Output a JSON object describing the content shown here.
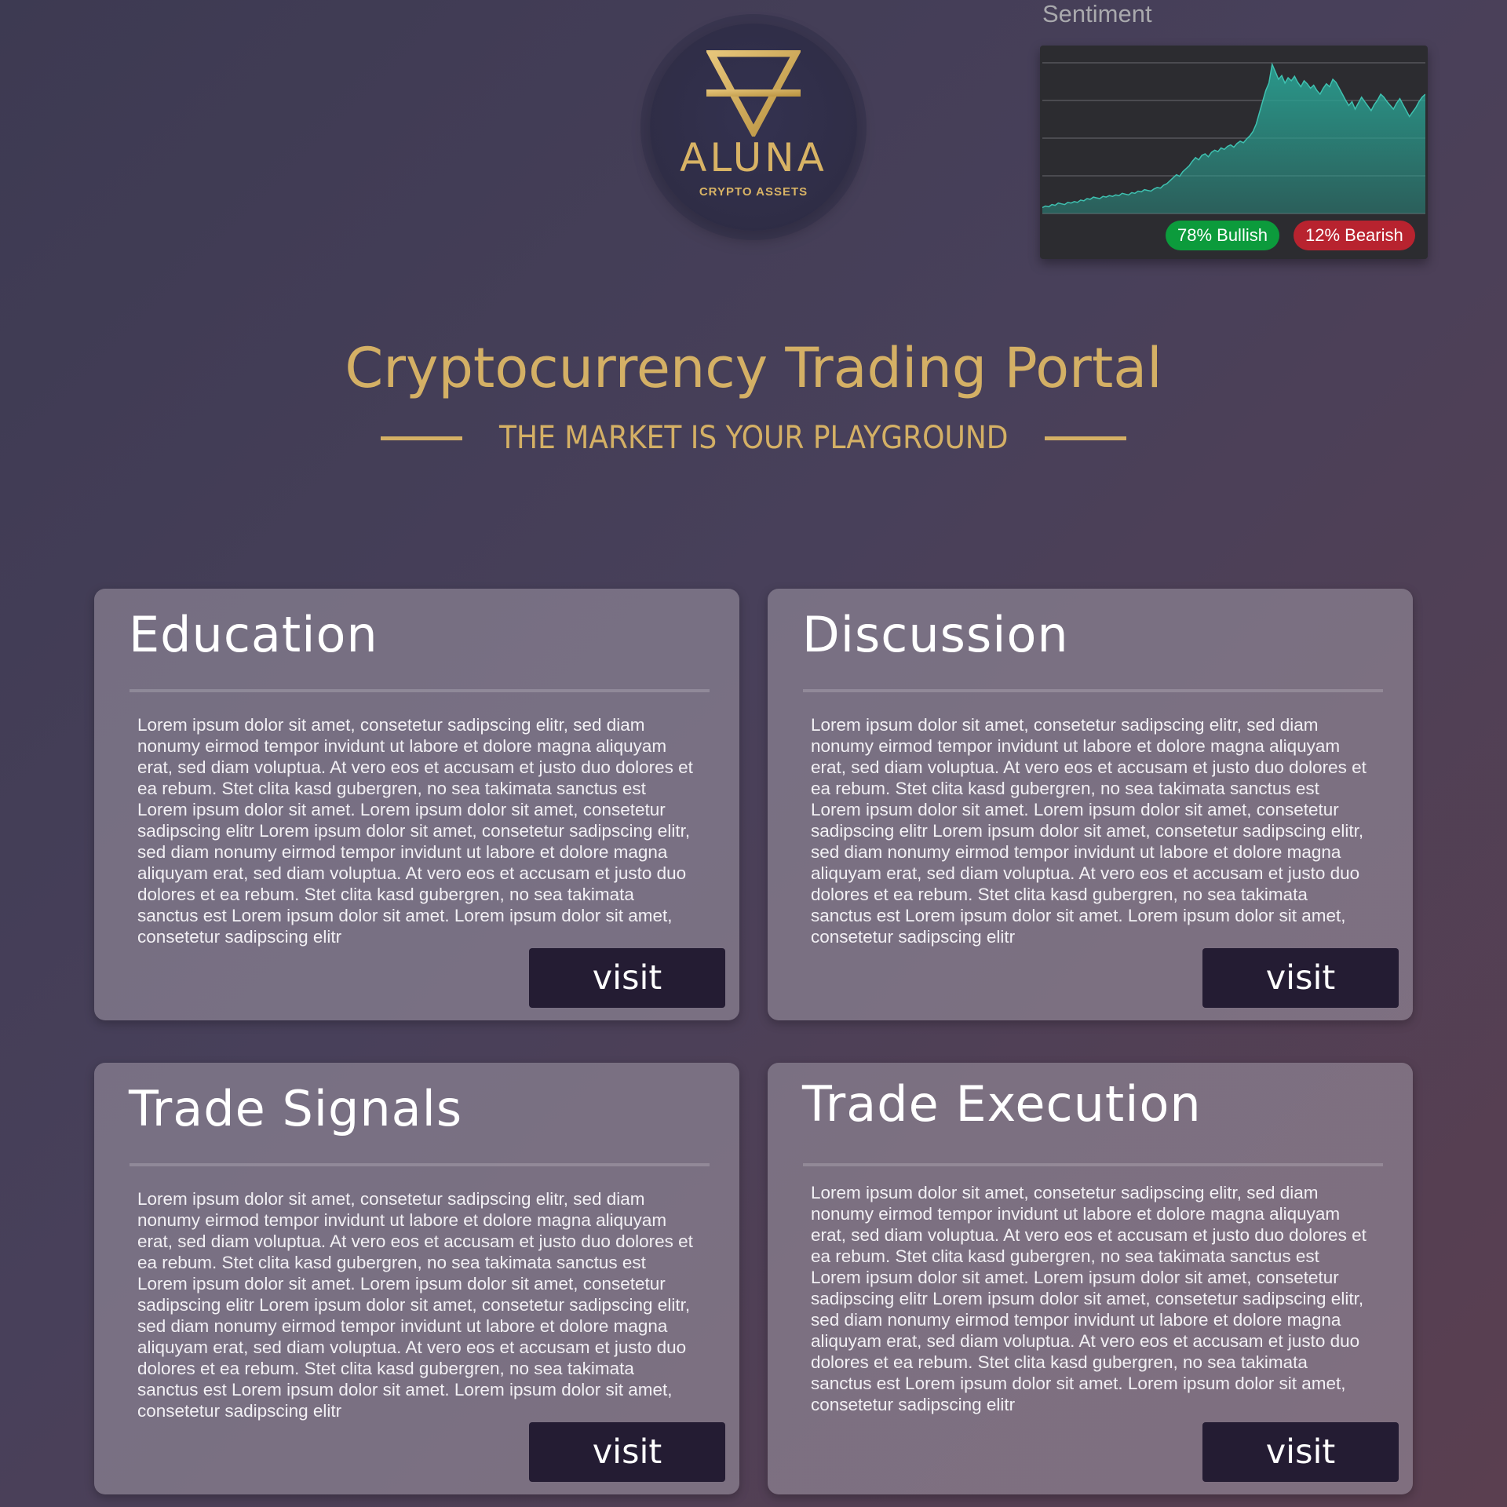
{
  "logo": {
    "brand": "ALUNA",
    "tagline": "CRYPTO ASSETS",
    "icon": "inverted-triangle-alchemy-icon",
    "color": "#d8b365"
  },
  "sentiment": {
    "label": "Sentiment",
    "bullish_text": "78% Bullish",
    "bearish_text": "12% Bearish",
    "bullish_pct": 78,
    "bearish_pct": 12,
    "bullish_color": "#0c9b3c",
    "bearish_color": "#b8232f",
    "chart_color": "#2a9d8f",
    "price_series": [
      8,
      10,
      9,
      12,
      11,
      14,
      13,
      12,
      15,
      14,
      16,
      15,
      18,
      17,
      20,
      19,
      22,
      21,
      20,
      23,
      22,
      24,
      23,
      25,
      24,
      27,
      26,
      25,
      28,
      27,
      30,
      29,
      32,
      31,
      30,
      33,
      35,
      34,
      38,
      40,
      44,
      48,
      52,
      50,
      56,
      60,
      64,
      70,
      75,
      72,
      78,
      80,
      76,
      82,
      85,
      83,
      88,
      86,
      90,
      92,
      89,
      94,
      97,
      95,
      100,
      104,
      110,
      120,
      135,
      150,
      165,
      175,
      200,
      190,
      180,
      185,
      175,
      182,
      178,
      184,
      176,
      170,
      178,
      174,
      168,
      172,
      165,
      160,
      168,
      174,
      170,
      180,
      176,
      168,
      160,
      152,
      145,
      150,
      140,
      148,
      156,
      150,
      144,
      138,
      146,
      152,
      160,
      156,
      150,
      145,
      140,
      148,
      154,
      146,
      138,
      130,
      136,
      142,
      150,
      156,
      160
    ]
  },
  "hero": {
    "title": "Cryptocurrency Trading Portal",
    "subtitle": "THE MARKET IS YOUR PLAYGROUND",
    "accent": "#d4b065"
  },
  "cards": [
    {
      "title": "Education",
      "body": "Lorem ipsum dolor sit amet, consetetur sadipscing elitr, sed diam nonumy eirmod tempor invidunt ut labore et dolore magna aliquyam erat, sed diam voluptua. At vero eos et accusam et justo duo dolores et ea rebum. Stet clita kasd gubergren, no sea takimata sanctus est Lorem ipsum dolor sit amet. Lorem ipsum dolor sit amet, consetetur sadipscing elitr Lorem ipsum dolor sit amet, consetetur sadipscing elitr, sed diam nonumy eirmod tempor invidunt ut labore et dolore magna aliquyam erat, sed diam voluptua. At vero eos et accusam et justo duo dolores et ea rebum. Stet clita kasd gubergren, no sea takimata sanctus est Lorem ipsum dolor sit amet. Lorem ipsum dolor sit amet, consetetur sadipscing elitr",
      "button": "visit"
    },
    {
      "title": "Discussion",
      "body": "Lorem ipsum dolor sit amet, consetetur sadipscing elitr, sed diam nonumy eirmod tempor invidunt ut labore et dolore magna aliquyam erat, sed diam voluptua. At vero eos et accusam et justo duo dolores et ea rebum. Stet clita kasd gubergren, no sea takimata sanctus est Lorem ipsum dolor sit amet. Lorem ipsum dolor sit amet, consetetur sadipscing elitr Lorem ipsum dolor sit amet, consetetur sadipscing elitr, sed diam nonumy eirmod tempor invidunt ut labore et dolore magna aliquyam erat, sed diam voluptua. At vero eos et accusam et justo duo dolores et ea rebum. Stet clita kasd gubergren, no sea takimata sanctus est Lorem ipsum dolor sit amet. Lorem ipsum dolor sit amet, consetetur sadipscing elitr",
      "button": "visit"
    },
    {
      "title": "Trade Signals",
      "body": "Lorem ipsum dolor sit amet, consetetur sadipscing elitr, sed diam nonumy eirmod tempor invidunt ut labore et dolore magna aliquyam erat, sed diam voluptua. At vero eos et accusam et justo duo dolores et ea rebum. Stet clita kasd gubergren, no sea takimata sanctus est Lorem ipsum dolor sit amet. Lorem ipsum dolor sit amet, consetetur sadipscing elitr Lorem ipsum dolor sit amet, consetetur sadipscing elitr, sed diam nonumy eirmod tempor invidunt ut labore et dolore magna aliquyam erat, sed diam voluptua. At vero eos et accusam et justo duo dolores et ea rebum. Stet clita kasd gubergren, no sea takimata sanctus est Lorem ipsum dolor sit amet. Lorem ipsum dolor sit amet, consetetur sadipscing elitr",
      "button": "visit"
    },
    {
      "title": "Trade Execution",
      "body": "Lorem ipsum dolor sit amet, consetetur sadipscing elitr, sed diam nonumy eirmod tempor invidunt ut labore et dolore magna aliquyam erat, sed diam voluptua. At vero eos et accusam et justo duo dolores et ea rebum. Stet clita kasd gubergren, no sea takimata sanctus est Lorem ipsum dolor sit amet. Lorem ipsum dolor sit amet, consetetur sadipscing elitr Lorem ipsum dolor sit amet, consetetur sadipscing elitr, sed diam nonumy eirmod tempor invidunt ut labore et dolore magna aliquyam erat, sed diam voluptua. At vero eos et accusam et justo duo dolores et ea rebum. Stet clita kasd gubergren, no sea takimata sanctus est Lorem ipsum dolor sit amet. Lorem ipsum dolor sit amet, consetetur sadipscing elitr",
      "button": "visit"
    }
  ]
}
